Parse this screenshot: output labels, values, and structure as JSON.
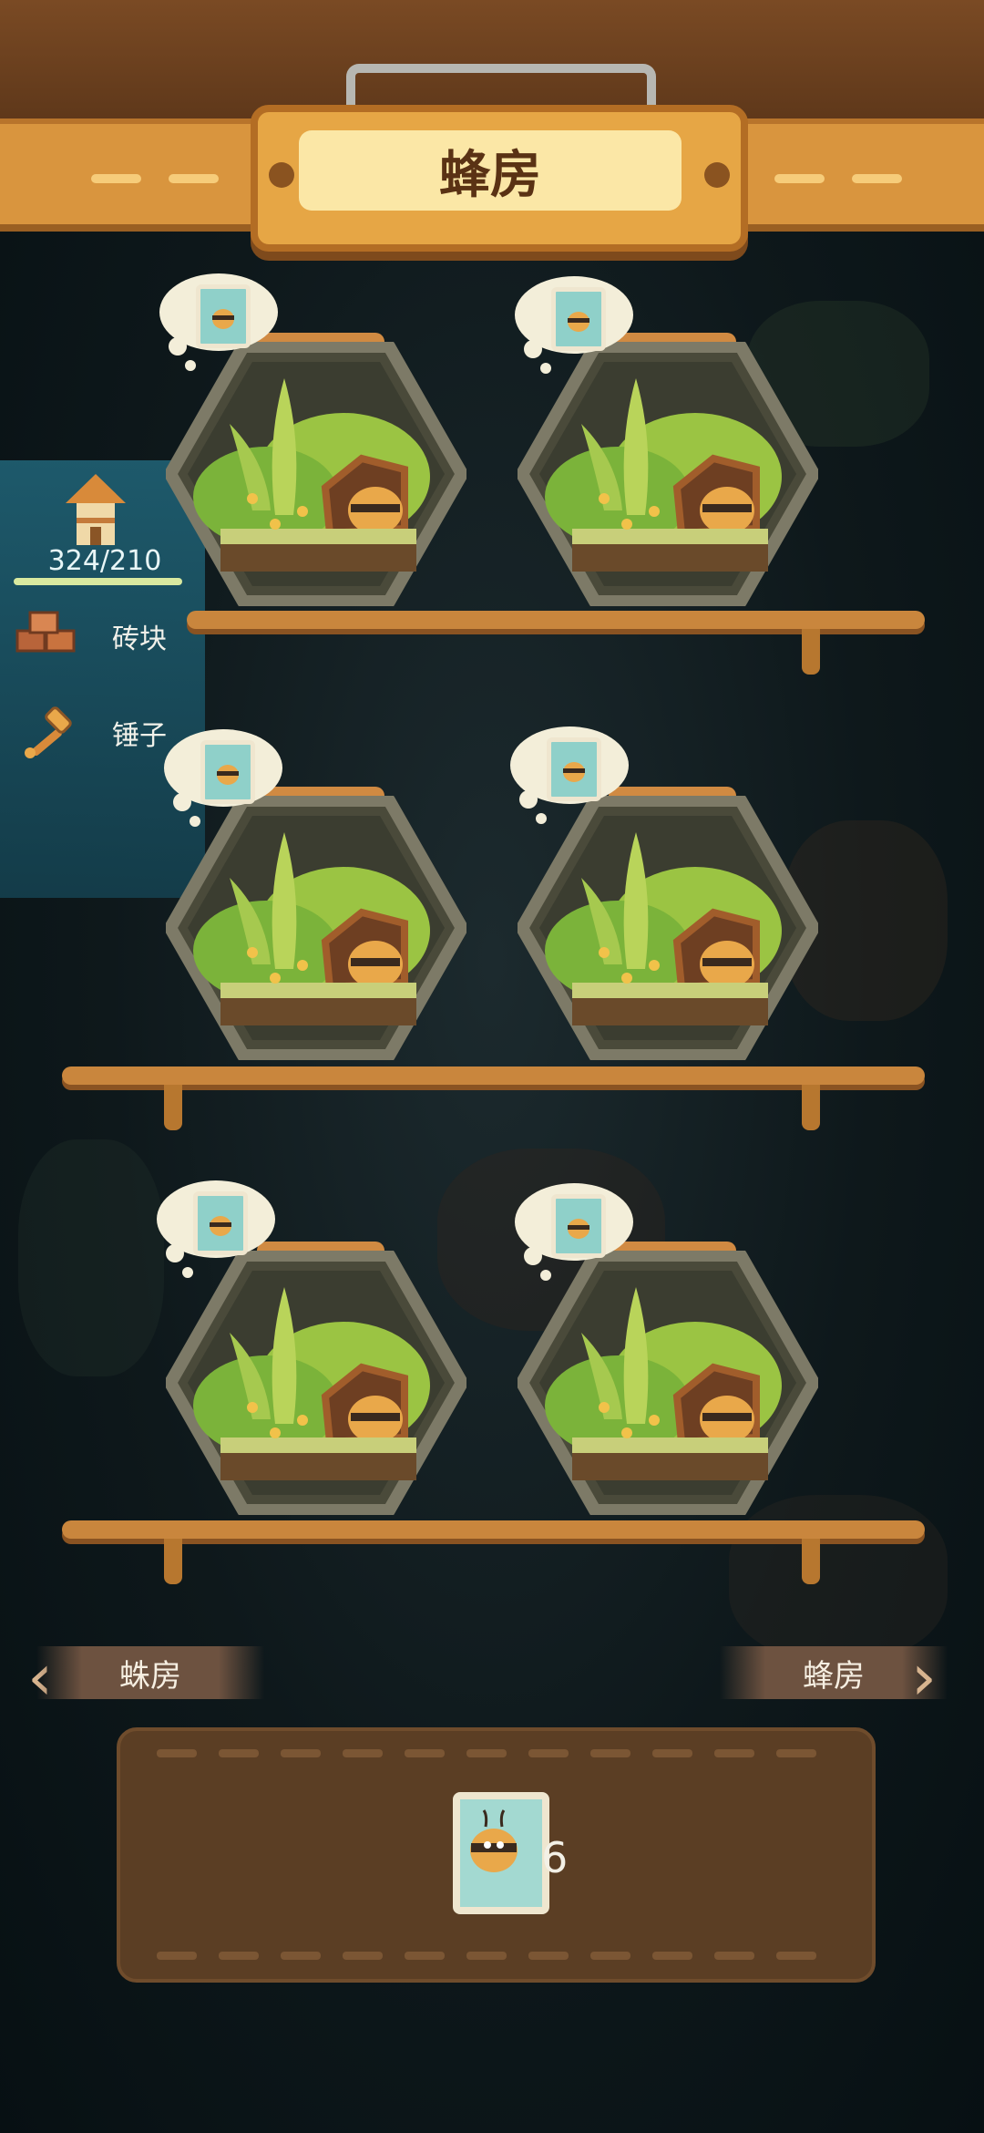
{
  "header": {
    "title": "蜂房"
  },
  "resources": {
    "capacity_text": "324/210",
    "items": [
      {
        "label": "砖块",
        "icon": "brick-icon"
      },
      {
        "label": "锤子",
        "icon": "hammer-icon"
      }
    ]
  },
  "jars": [
    {
      "slot": 1,
      "thought_icon": "bee-card-icon",
      "occupant": "bee"
    },
    {
      "slot": 2,
      "thought_icon": "bee-card-icon",
      "occupant": "bee"
    },
    {
      "slot": 3,
      "thought_icon": "bee-card-icon",
      "occupant": "bee"
    },
    {
      "slot": 4,
      "thought_icon": "bee-card-icon",
      "occupant": "bee"
    },
    {
      "slot": 5,
      "thought_icon": "bee-card-icon",
      "occupant": "bee"
    },
    {
      "slot": 6,
      "thought_icon": "bee-card-icon",
      "occupant": "bee"
    }
  ],
  "navigation": {
    "prev_label": "蛛房",
    "next_label": "蜂房"
  },
  "inventory": {
    "item_icon": "bee-seed-pack-icon",
    "count": "6"
  },
  "colors": {
    "wood": "#c9863d",
    "plaque": "#e6a645",
    "panel": "#1f5f72",
    "tray": "#5b3e24"
  }
}
